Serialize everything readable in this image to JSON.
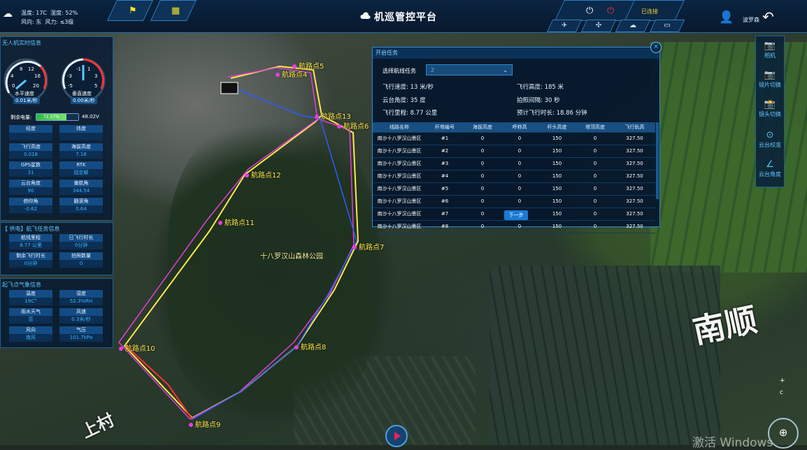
{
  "header": {
    "title": "机巡管控平台",
    "weather": {
      "temp_label": "温度",
      "temp": "17C",
      "humidity_label": "湿度",
      "humidity": "52%",
      "wind_dir_label": "风向",
      "wind_dir": "东",
      "wind_force_label": "风力",
      "wind_force": "≤3级"
    },
    "connection_status": "已连接",
    "user_name": "波罗森",
    "tab_icons": [
      "drone-icon",
      "plane-icon",
      "cloud-icon",
      "screen-icon"
    ]
  },
  "left_panel": {
    "realtime_title": "无人机实时信息",
    "gauge_h": {
      "ticks": [
        "8",
        "12",
        "4",
        "16",
        "0",
        "20"
      ],
      "label": "水平速度",
      "value": "0.01米/秒"
    },
    "gauge_v": {
      "ticks": [
        "-1",
        "1",
        "-3",
        "3",
        "-5",
        "5"
      ],
      "label": "垂直速度",
      "value": "0.00米/秒"
    },
    "battery": {
      "label": "剩余电量:",
      "percent_text": "71.57%",
      "percent": 71.57,
      "voltage": "48.02V"
    },
    "fields": [
      {
        "k": "经度",
        "v": ""
      },
      {
        "k": "纬度",
        "v": ""
      },
      {
        "k": "飞行高度",
        "v": "0.018"
      },
      {
        "k": "海拔高度",
        "v": "7.18"
      },
      {
        "k": "GPS星数",
        "v": "31"
      },
      {
        "k": "RTK",
        "v": "固定解"
      },
      {
        "k": "云台角度",
        "v": "90"
      },
      {
        "k": "偏航角",
        "v": "344.54"
      },
      {
        "k": "俯仰角",
        "v": "-0.62"
      },
      {
        "k": "翻滚角",
        "v": "0.64"
      }
    ],
    "task_title": "【  供电】航飞任务信息",
    "task_fields": [
      {
        "k": "航线里程",
        "v": "8.77 公里"
      },
      {
        "k": "已飞行时长",
        "v": "0分钟"
      },
      {
        "k": "剩余飞行时长",
        "v": "0分钟"
      },
      {
        "k": "拍照数量",
        "v": "0"
      }
    ],
    "weather_title": "起飞点气象信息",
    "weather_fields": [
      {
        "k": "温度",
        "v": "19C°"
      },
      {
        "k": "湿度",
        "v": "52.3%RH"
      },
      {
        "k": "雨水天气",
        "v": "否"
      },
      {
        "k": "风速",
        "v": "0.3米/秒"
      },
      {
        "k": "风向",
        "v": "南风"
      },
      {
        "k": "气压",
        "v": "101.7kPa"
      }
    ]
  },
  "right_toolbar": [
    {
      "icon": "camera-icon",
      "label": "相机"
    },
    {
      "icon": "switch-image-icon",
      "label": "镜片切换"
    },
    {
      "icon": "lens-switch-icon",
      "label": "镜头切换"
    },
    {
      "icon": "gimbal-calibrate-icon",
      "label": "云台校准"
    },
    {
      "icon": "gimbal-angle-icon",
      "label": "云台角度"
    }
  ],
  "task_dialog": {
    "title": "开启任务",
    "route_select_label": "选择航线任务",
    "route_select_value": "2",
    "info": {
      "speed": "飞行速度: 13 米/秒",
      "height": "飞行高度: 185 米",
      "gimbal": "云台角度: 35 度",
      "interval": "拍照间隔: 30 秒",
      "mileage": "飞行里程: 8.77 公里",
      "duration": "预计飞行时长: 18.86 分钟"
    },
    "columns": [
      "线路名称",
      "杆塔编号",
      "海拔高度",
      "呼称高",
      "杆头高度",
      "塔顶高度",
      "飞行轨高"
    ],
    "rows": [
      [
        "南沙十八罗汉山景区",
        "#1",
        "0",
        "0",
        "150",
        "0",
        "327.50"
      ],
      [
        "南沙十八罗汉山景区",
        "#2",
        "0",
        "0",
        "150",
        "0",
        "327.50"
      ],
      [
        "南沙十八罗汉山景区",
        "#3",
        "0",
        "0",
        "150",
        "0",
        "327.50"
      ],
      [
        "南沙十八罗汉山景区",
        "#4",
        "0",
        "0",
        "150",
        "0",
        "327.50"
      ],
      [
        "南沙十八罗汉山景区",
        "#5",
        "0",
        "0",
        "150",
        "0",
        "327.50"
      ],
      [
        "南沙十八罗汉山景区",
        "#6",
        "0",
        "0",
        "150",
        "0",
        "327.50"
      ],
      [
        "南沙十八罗汉山景区",
        "#7",
        "0",
        "0",
        "150",
        "0",
        "327.50"
      ],
      [
        "南沙十八罗汉山景区",
        "#8",
        "0",
        "0",
        "150",
        "0",
        "327.50"
      ]
    ],
    "next_label": "下一步"
  },
  "map": {
    "waypoints": [
      "航路点4",
      "航路点13",
      "航路点6",
      "航路点12",
      "航路点11",
      "航路点7",
      "航路点10",
      "航路点8",
      "航路点9",
      "航路点5"
    ],
    "labels": [
      "十八罗汉山森林公园",
      "上村",
      "南顺"
    ],
    "watermark": "激活 Windows",
    "zoom_in": "+",
    "zoom_reset": "c"
  }
}
